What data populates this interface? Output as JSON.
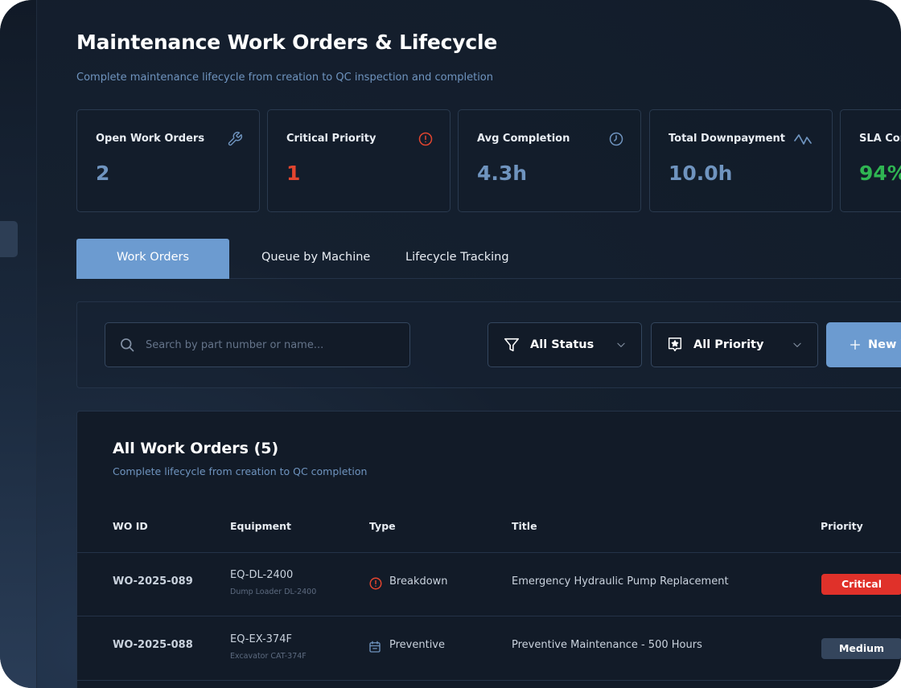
{
  "page": {
    "title": "Maintenance Work Orders & Lifecycle",
    "subtitle": "Complete maintenance lifecycle from creation to QC inspection and completion"
  },
  "stats": [
    {
      "label": "Open Work Orders",
      "value": "2",
      "icon": "wrench-icon",
      "color": "#6f94bf"
    },
    {
      "label": "Critical Priority",
      "value": "1",
      "icon": "alert-circle-icon",
      "color": "#e2452f"
    },
    {
      "label": "Avg Completion",
      "value": "4.3h",
      "icon": "clock-icon",
      "color": "#6f94bf"
    },
    {
      "label": "Total Downpayment",
      "value": "10.0h",
      "icon": "activity-icon",
      "color": "#6f94bf"
    },
    {
      "label": "SLA Com",
      "value": "94%",
      "icon": "",
      "color": "#2fb552"
    }
  ],
  "tabs": [
    {
      "label": "Work Orders",
      "active": true
    },
    {
      "label": "Queue by Machine",
      "active": false
    },
    {
      "label": "Lifecycle Tracking",
      "active": false
    }
  ],
  "filters": {
    "search_placeholder": "Search by part number or name...",
    "status": "All Status",
    "priority": "All Priority",
    "new_button": "New W"
  },
  "table": {
    "title": "All Work Orders (5)",
    "subtitle": "Complete lifecycle from creation to QC completion",
    "columns": [
      "WO ID",
      "Equipment",
      "Type",
      "Title",
      "Priority"
    ],
    "rows": [
      {
        "id": "WO-2025-089",
        "equipment": "EQ-DL-2400",
        "equipment_name": "Dump Loader DL-2400",
        "type": "Breakdown",
        "type_icon": "alert-circle-icon",
        "title": "Emergency Hydraulic Pump Replacement",
        "priority": "Critical",
        "priority_color": "#e0312a"
      },
      {
        "id": "WO-2025-088",
        "equipment": "EQ-EX-374F",
        "equipment_name": "Excavator CAT-374F",
        "type": "Preventive",
        "type_icon": "calendar-icon",
        "title": "Preventive Maintenance - 500 Hours",
        "priority": "Medium",
        "priority_color": "#34455c"
      }
    ]
  },
  "colors": {
    "accent": "#6c9bd0",
    "background": "#121c2a",
    "critical": "#e0312a",
    "success": "#2fb552"
  }
}
